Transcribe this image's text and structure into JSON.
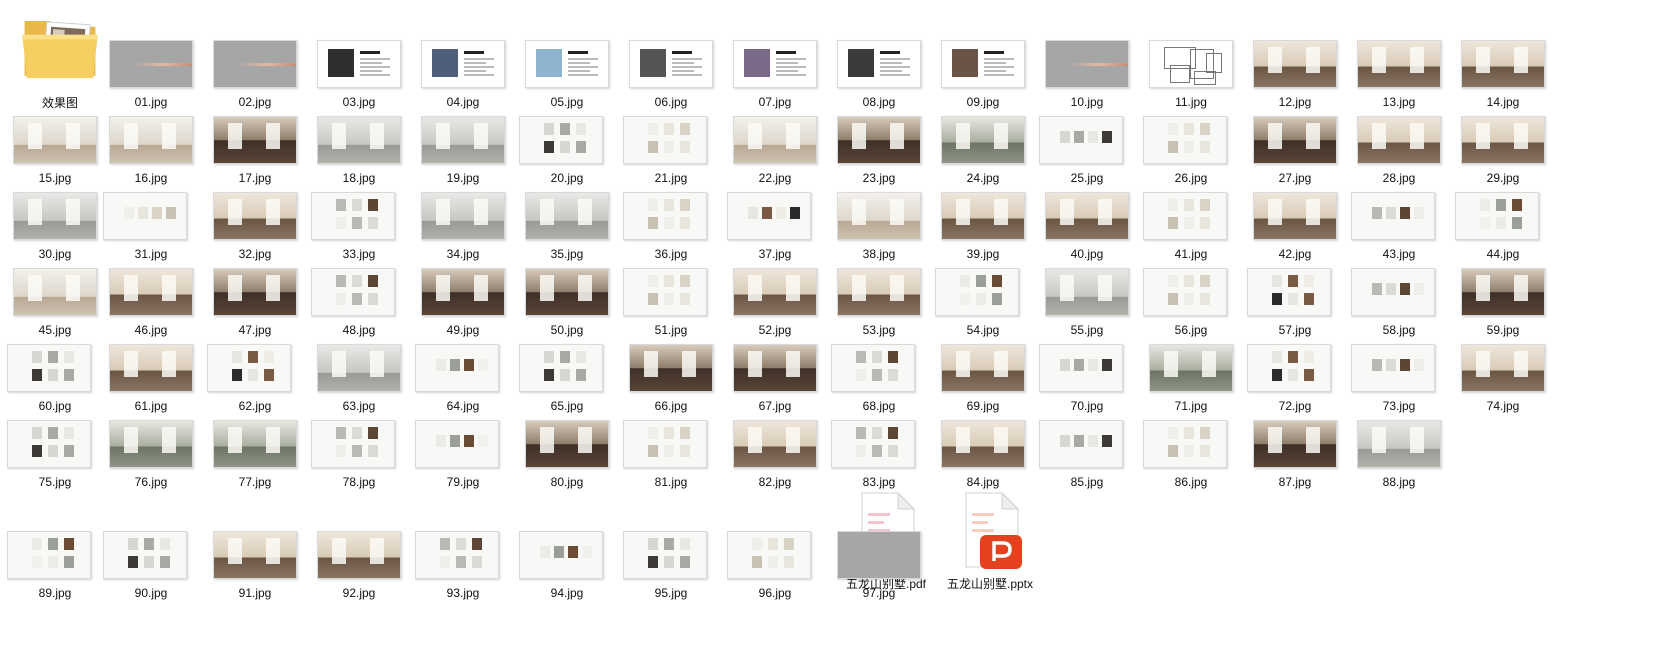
{
  "folder": {
    "label": "效果图",
    "icon": "folder-icon"
  },
  "files": [
    {
      "label": "01.jpg",
      "kind": "gray"
    },
    {
      "label": "02.jpg",
      "kind": "gray"
    },
    {
      "label": "03.jpg",
      "kind": "doc"
    },
    {
      "label": "04.jpg",
      "kind": "doc"
    },
    {
      "label": "05.jpg",
      "kind": "doc"
    },
    {
      "label": "06.jpg",
      "kind": "doc"
    },
    {
      "label": "07.jpg",
      "kind": "doc"
    },
    {
      "label": "08.jpg",
      "kind": "doc"
    },
    {
      "label": "09.jpg",
      "kind": "doc"
    },
    {
      "label": "10.jpg",
      "kind": "gray"
    },
    {
      "label": "11.jpg",
      "kind": "plan"
    },
    {
      "label": "12.jpg",
      "kind": "warm"
    },
    {
      "label": "13.jpg",
      "kind": "warm"
    },
    {
      "label": "14.jpg",
      "kind": "warm"
    },
    {
      "label": "15.jpg",
      "kind": "light"
    },
    {
      "label": "16.jpg",
      "kind": "light"
    },
    {
      "label": "17.jpg",
      "kind": "dark"
    },
    {
      "label": "18.jpg",
      "kind": "grey"
    },
    {
      "label": "19.jpg",
      "kind": "grey"
    },
    {
      "label": "20.jpg",
      "kind": "swatch"
    },
    {
      "label": "21.jpg",
      "kind": "swatch"
    },
    {
      "label": "22.jpg",
      "kind": "light"
    },
    {
      "label": "23.jpg",
      "kind": "dark"
    },
    {
      "label": "24.jpg",
      "kind": "green"
    },
    {
      "label": "25.jpg",
      "kind": "swatch"
    },
    {
      "label": "26.jpg",
      "kind": "swatch"
    },
    {
      "label": "27.jpg",
      "kind": "dark"
    },
    {
      "label": "28.jpg",
      "kind": "warm"
    },
    {
      "label": "29.jpg",
      "kind": "warm"
    },
    {
      "label": "30.jpg",
      "kind": "grey"
    },
    {
      "label": "31.jpg",
      "kind": "swatch"
    },
    {
      "label": "32.jpg",
      "kind": "warm"
    },
    {
      "label": "33.jpg",
      "kind": "swatch"
    },
    {
      "label": "34.jpg",
      "kind": "grey"
    },
    {
      "label": "35.jpg",
      "kind": "grey"
    },
    {
      "label": "36.jpg",
      "kind": "swatch"
    },
    {
      "label": "37.jpg",
      "kind": "swatch"
    },
    {
      "label": "38.jpg",
      "kind": "light"
    },
    {
      "label": "39.jpg",
      "kind": "warm"
    },
    {
      "label": "40.jpg",
      "kind": "warm"
    },
    {
      "label": "41.jpg",
      "kind": "swatch"
    },
    {
      "label": "42.jpg",
      "kind": "warm"
    },
    {
      "label": "43.jpg",
      "kind": "swatch"
    },
    {
      "label": "44.jpg",
      "kind": "swatch"
    },
    {
      "label": "45.jpg",
      "kind": "light"
    },
    {
      "label": "46.jpg",
      "kind": "warm"
    },
    {
      "label": "47.jpg",
      "kind": "dark"
    },
    {
      "label": "48.jpg",
      "kind": "swatch"
    },
    {
      "label": "49.jpg",
      "kind": "dark"
    },
    {
      "label": "50.jpg",
      "kind": "dark"
    },
    {
      "label": "51.jpg",
      "kind": "swatch"
    },
    {
      "label": "52.jpg",
      "kind": "warm"
    },
    {
      "label": "53.jpg",
      "kind": "warm"
    },
    {
      "label": "54.jpg",
      "kind": "swatch"
    },
    {
      "label": "55.jpg",
      "kind": "grey"
    },
    {
      "label": "56.jpg",
      "kind": "swatch"
    },
    {
      "label": "57.jpg",
      "kind": "swatch"
    },
    {
      "label": "58.jpg",
      "kind": "swatch"
    },
    {
      "label": "59.jpg",
      "kind": "dark"
    },
    {
      "label": "60.jpg",
      "kind": "swatch"
    },
    {
      "label": "61.jpg",
      "kind": "warm"
    },
    {
      "label": "62.jpg",
      "kind": "swatch"
    },
    {
      "label": "63.jpg",
      "kind": "grey"
    },
    {
      "label": "64.jpg",
      "kind": "swatch"
    },
    {
      "label": "65.jpg",
      "kind": "swatch"
    },
    {
      "label": "66.jpg",
      "kind": "dark"
    },
    {
      "label": "67.jpg",
      "kind": "dark"
    },
    {
      "label": "68.jpg",
      "kind": "swatch"
    },
    {
      "label": "69.jpg",
      "kind": "warm"
    },
    {
      "label": "70.jpg",
      "kind": "swatch"
    },
    {
      "label": "71.jpg",
      "kind": "green"
    },
    {
      "label": "72.jpg",
      "kind": "swatch"
    },
    {
      "label": "73.jpg",
      "kind": "swatch"
    },
    {
      "label": "74.jpg",
      "kind": "warm"
    },
    {
      "label": "75.jpg",
      "kind": "swatch"
    },
    {
      "label": "76.jpg",
      "kind": "green"
    },
    {
      "label": "77.jpg",
      "kind": "green"
    },
    {
      "label": "78.jpg",
      "kind": "swatch"
    },
    {
      "label": "79.jpg",
      "kind": "swatch"
    },
    {
      "label": "80.jpg",
      "kind": "dark"
    },
    {
      "label": "81.jpg",
      "kind": "swatch"
    },
    {
      "label": "82.jpg",
      "kind": "warm"
    },
    {
      "label": "83.jpg",
      "kind": "swatch"
    },
    {
      "label": "84.jpg",
      "kind": "warm"
    },
    {
      "label": "85.jpg",
      "kind": "swatch"
    },
    {
      "label": "86.jpg",
      "kind": "swatch"
    },
    {
      "label": "87.jpg",
      "kind": "dark"
    },
    {
      "label": "88.jpg",
      "kind": "grey"
    },
    {
      "label": "89.jpg",
      "kind": "swatch"
    },
    {
      "label": "90.jpg",
      "kind": "swatch"
    },
    {
      "label": "91.jpg",
      "kind": "warm"
    },
    {
      "label": "92.jpg",
      "kind": "warm"
    },
    {
      "label": "93.jpg",
      "kind": "swatch"
    },
    {
      "label": "94.jpg",
      "kind": "swatch"
    },
    {
      "label": "95.jpg",
      "kind": "swatch"
    },
    {
      "label": "96.jpg",
      "kind": "swatch"
    },
    {
      "label": "97.jpg",
      "kind": "gray"
    }
  ],
  "documents": [
    {
      "label": "五龙山别墅.pdf",
      "icon": "pdf-file-icon",
      "glyph": "P",
      "color": "#e8245c"
    },
    {
      "label": "五龙山别墅.pptx",
      "icon": "pptx-file-icon",
      "glyph": "P",
      "color": "#e4421f"
    }
  ]
}
